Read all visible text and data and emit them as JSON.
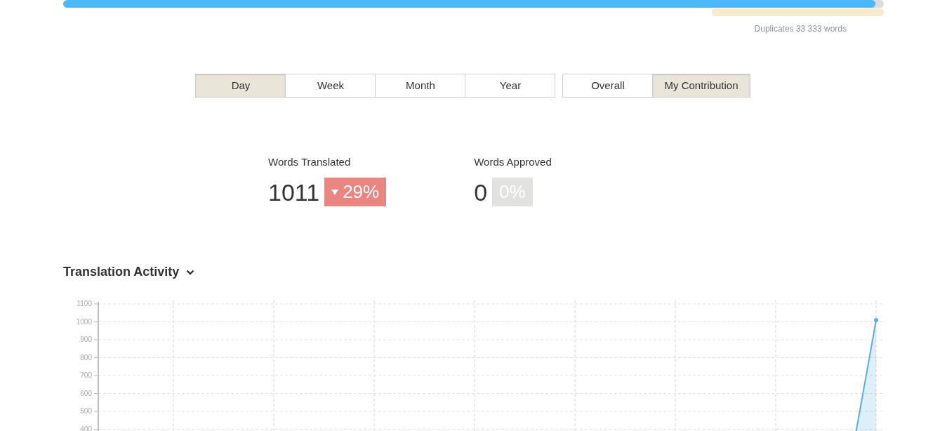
{
  "progress": {
    "level": 0.99,
    "duplicates": {
      "level": 0.21,
      "text": "Duplicates 33 333 words"
    }
  },
  "period_tabs": [
    {
      "label": "Day",
      "selected": true
    },
    {
      "label": "Week",
      "selected": false
    },
    {
      "label": "Month",
      "selected": false
    },
    {
      "label": "Year",
      "selected": false
    }
  ],
  "scope_tabs": [
    {
      "label": "Overall",
      "selected": false
    },
    {
      "label": "My Contribution",
      "selected": true
    }
  ],
  "stats": [
    {
      "label": "Words Translated",
      "value": "1011",
      "change": "29%",
      "kind": "decrease"
    },
    {
      "label": "Words Approved",
      "value": "0",
      "change": "0%",
      "kind": "neutral"
    }
  ],
  "activity": {
    "title": "Translation Activity",
    "expanded": true,
    "y_axis_labels": [
      "1100",
      "1000",
      "900",
      "800",
      "700",
      "600",
      "500",
      "400"
    ]
  }
}
